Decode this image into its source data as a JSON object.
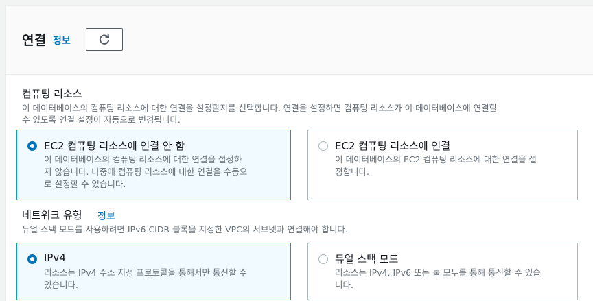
{
  "header": {
    "title": "연결",
    "info_label": "정보",
    "refresh_icon": "refresh-icon"
  },
  "compute": {
    "label": "컴퓨팅 리소스",
    "description_line1": "이 데이터베이스의 컴퓨팅 리소스에 대한 연결을 설정할지를 선택합니다. 연결을 설정하면 컴퓨팅 리소스가 이 데이터베이스에 연결할",
    "description_line2": "수 있도록 연결 설정이 자동으로 변경됩니다.",
    "options": [
      {
        "title": "EC2 컴퓨팅 리소스에 연결 안 함",
        "desc_lines": [
          "이 데이터베이스의 컴퓨팅 리소스에 대한 연결을 설정하",
          "지 않습니다. 나중에 컴퓨팅 리소스에 대한 연결을 수동으",
          "로 설정할 수 있습니다."
        ],
        "selected": true
      },
      {
        "title": "EC2 컴퓨팅 리소스에 연결",
        "desc_lines": [
          "이 데이터베이스의 EC2 컴퓨팅 리소스에 대한 연결을 설",
          "정합니다."
        ],
        "selected": false
      }
    ]
  },
  "network": {
    "label": "네트워크 유형",
    "info_label": "정보",
    "description": "듀얼 스택 모드를 사용하려면 IPv6 CIDR 블록을 지정한 VPC의 서브넷과 연결해야 합니다.",
    "options": [
      {
        "title": "IPv4",
        "desc_lines": [
          "리소스는 IPv4 주소 지정 프로토콜을 통해서만 통신할 수",
          "있습니다."
        ],
        "selected": true
      },
      {
        "title": "듀얼 스택 모드",
        "desc_lines": [
          "리소스는 IPv4, IPv6 또는 둘 모두를 통해 통신할 수 있습",
          "니다."
        ],
        "selected": false
      }
    ]
  },
  "colors": {
    "link": "#0073bb",
    "selected_border": "#00a1c9",
    "selected_bg": "#f1faff",
    "muted_text": "#687078"
  }
}
